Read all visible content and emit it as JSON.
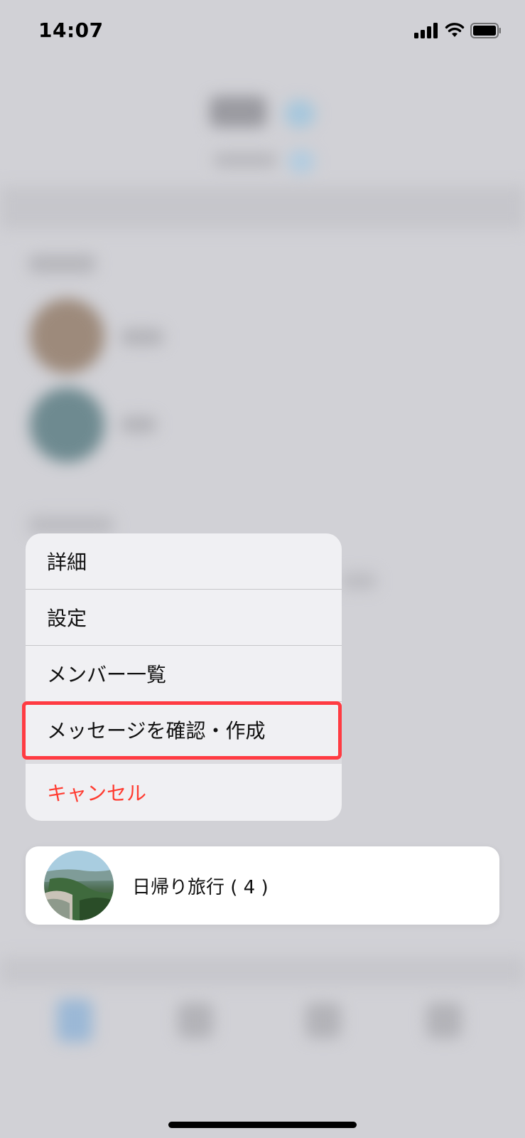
{
  "status_bar": {
    "time": "14:07"
  },
  "menu": {
    "items": [
      {
        "label": "詳細"
      },
      {
        "label": "設定"
      },
      {
        "label": "メンバー一覧"
      },
      {
        "label": "メッセージを確認・作成"
      }
    ],
    "cancel_label": "キャンセル"
  },
  "group_card": {
    "name": "日帰り旅行 ( 4 )",
    "avatar_icon": "group-photo-avatar"
  },
  "colors": {
    "overlay_background": "#d1d1d6",
    "cancel": "#ff3b30",
    "highlight_border": "#ff3b42"
  }
}
